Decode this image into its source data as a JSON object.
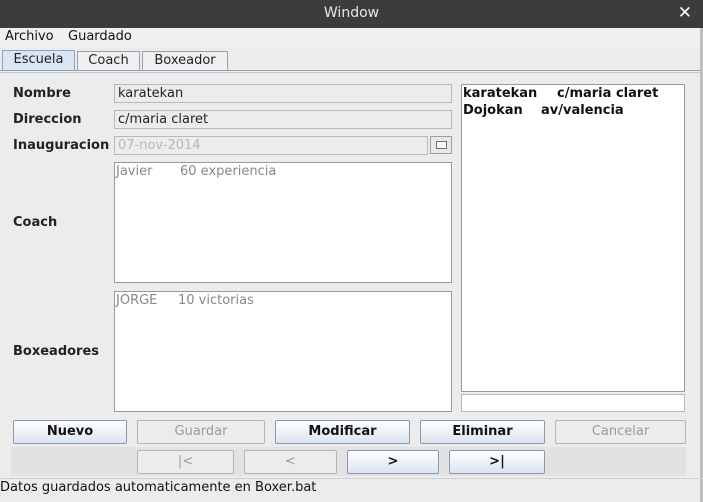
{
  "window": {
    "title": "Window",
    "close_label": "✕"
  },
  "menu": {
    "file": "Archivo",
    "saved": "Guardado"
  },
  "tabs": {
    "school": "Escuela",
    "coach": "Coach",
    "boxer": "Boxeador"
  },
  "form": {
    "name_label": "Nombre",
    "name_value": "karatekan",
    "address_label": "Direccion",
    "address_value": "c/maria claret",
    "opening_label": "Inauguracion",
    "opening_value": "07-nov-2014",
    "coach_label": "Coach",
    "boxers_label": "Boxeadores"
  },
  "coach_list": [
    {
      "name": "Javier",
      "detail": "60 experiencia"
    }
  ],
  "boxer_list": [
    {
      "name": "JORGE",
      "detail": "10 victorias"
    }
  ],
  "schools_list": [
    {
      "name": "karatekan",
      "address": "c/maria claret"
    },
    {
      "name": "Dojokan",
      "address": "av/valencia"
    }
  ],
  "search_value": "",
  "buttons": {
    "new": "Nuevo",
    "save": "Guardar",
    "modify": "Modificar",
    "delete": "Eliminar",
    "cancel": "Cancelar"
  },
  "nav": {
    "first": "|<",
    "prev": "<",
    "next": ">",
    "last": ">|"
  },
  "status": "Datos guardados automaticamente en Boxer.bat"
}
